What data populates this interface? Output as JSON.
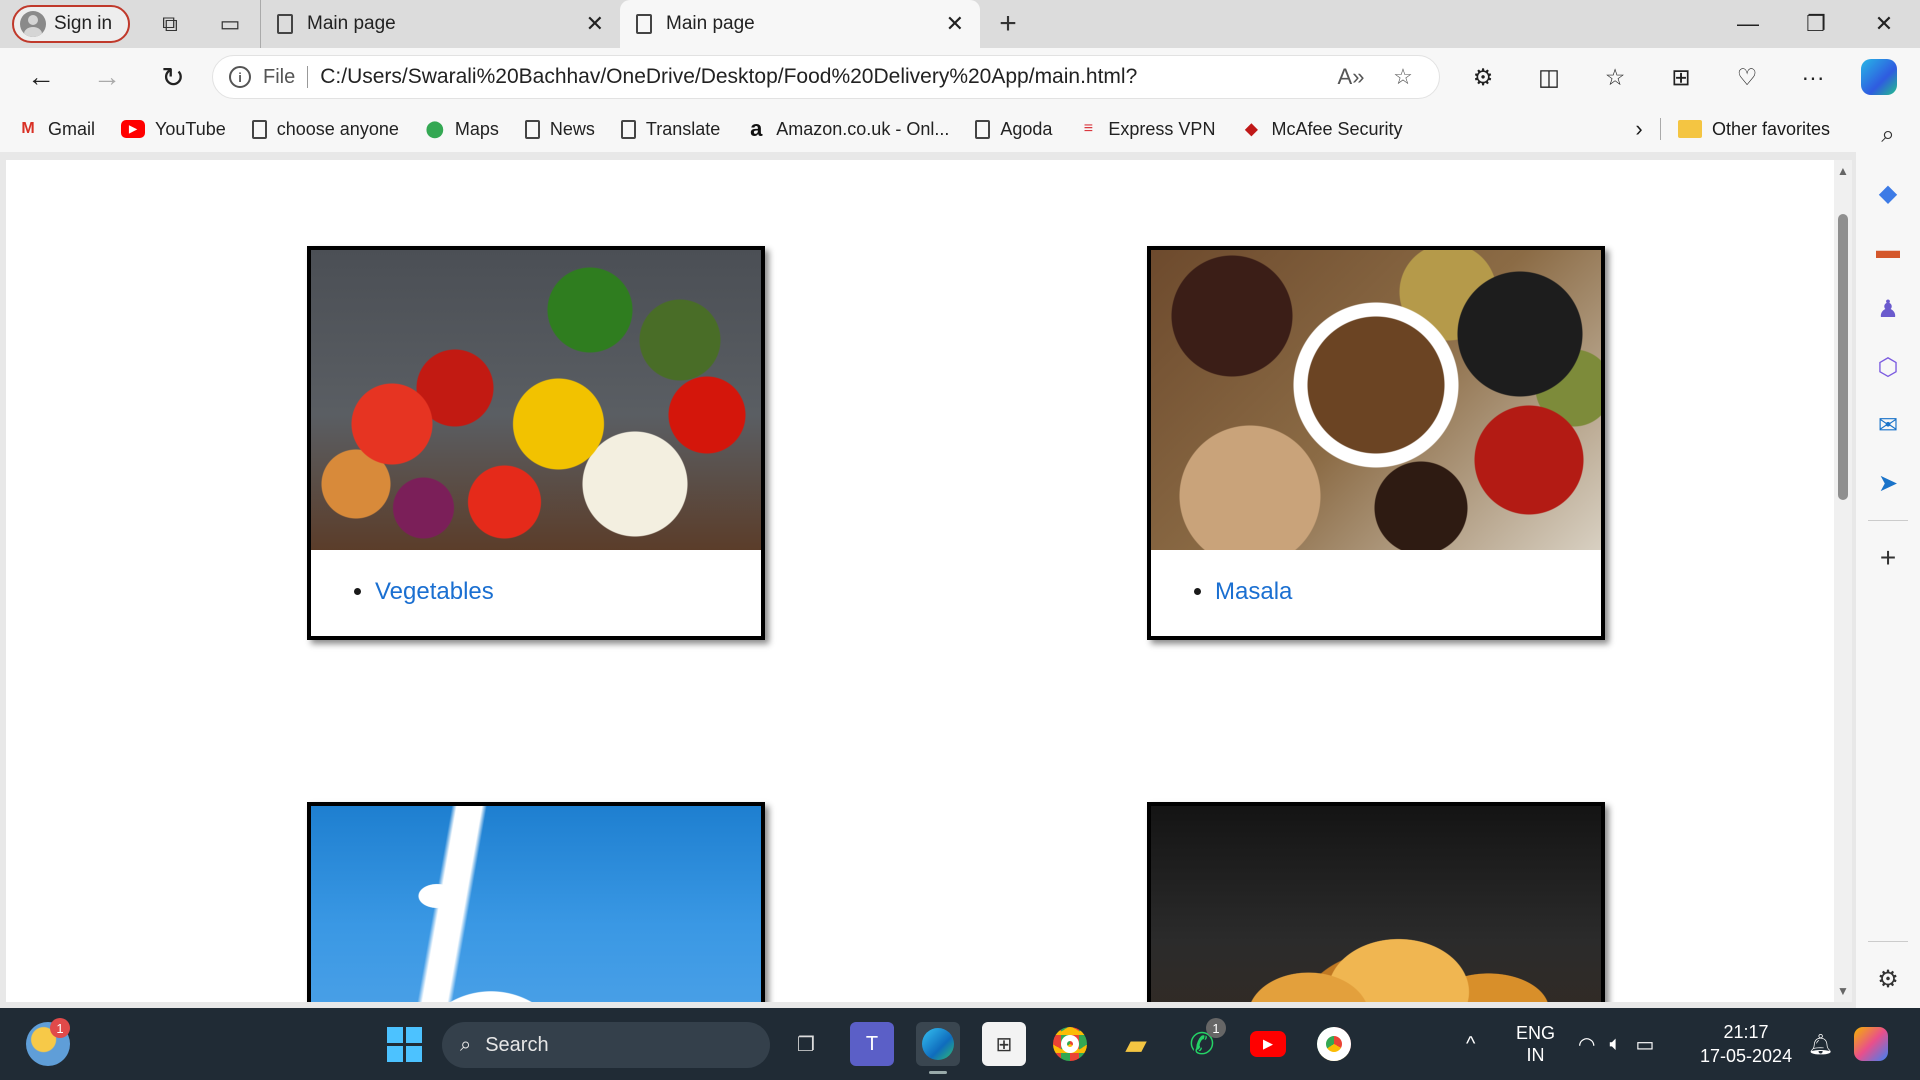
{
  "tabs": {
    "sign_in": "Sign in",
    "items": [
      {
        "label": "Main page",
        "close": "✕"
      },
      {
        "label": "Main page",
        "close": "✕"
      }
    ],
    "new_tab": "+"
  },
  "window": {
    "minimize": "—",
    "restore": "❐",
    "close": "✕"
  },
  "address": {
    "file_label": "File",
    "url": "C:/Users/Swarali%20Bachhav/OneDrive/Desktop/Food%20Delivery%20App/main.html?"
  },
  "favorites": {
    "items": [
      {
        "label": "Gmail",
        "icon": "gmail-icon"
      },
      {
        "label": "YouTube",
        "icon": "youtube-icon"
      },
      {
        "label": "choose anyone",
        "icon": "page-icon"
      },
      {
        "label": "Maps",
        "icon": "maps-icon"
      },
      {
        "label": "News",
        "icon": "page-icon"
      },
      {
        "label": "Translate",
        "icon": "page-icon"
      },
      {
        "label": "Amazon.co.uk - Onl...",
        "icon": "amazon-icon"
      },
      {
        "label": "Agoda",
        "icon": "page-icon"
      },
      {
        "label": "Express VPN",
        "icon": "expressvpn-icon"
      },
      {
        "label": "McAfee Security",
        "icon": "mcafee-icon"
      }
    ],
    "other": "Other favorites"
  },
  "cards": [
    {
      "label": "Vegetables",
      "image": "vegetables-image"
    },
    {
      "label": "Masala",
      "image": "masala-image"
    },
    {
      "label": "",
      "image": "milk-image"
    },
    {
      "label": "",
      "image": "chips-image"
    }
  ],
  "taskbar": {
    "search_placeholder": "Search",
    "weather_badge": "1",
    "whatsapp_badge": "1",
    "language_top": "ENG",
    "language_bottom": "IN",
    "time": "21:17",
    "date": "17-05-2024"
  },
  "colors": {
    "link": "#1a6fd1",
    "signin_border": "#c0392b",
    "taskbar": "#202b35"
  }
}
